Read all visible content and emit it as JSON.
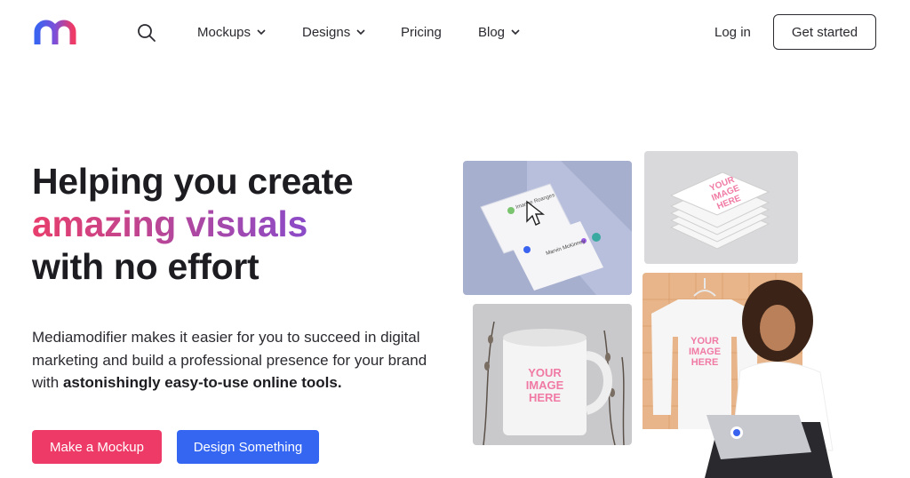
{
  "header": {
    "nav": [
      {
        "label": "Mockups",
        "has_dropdown": true
      },
      {
        "label": "Designs",
        "has_dropdown": true
      },
      {
        "label": "Pricing",
        "has_dropdown": false
      },
      {
        "label": "Blog",
        "has_dropdown": true
      }
    ],
    "login_label": "Log in",
    "get_started_label": "Get started"
  },
  "hero": {
    "title_line1": "Helping you create",
    "title_line2": "amazing visuals",
    "title_line3": "with no effort",
    "description_plain": "Mediamodifier makes it easier for you to succeed in digital marketing and build a professional presence for your brand with ",
    "description_bold": "astonishingly easy-to-use online tools.",
    "primary_button": "Make a Mockup",
    "secondary_button": "Design Something"
  },
  "gallery": {
    "placeholder_text_line1": "YOUR",
    "placeholder_text_line2": "IMAGE",
    "placeholder_text_line3": "HERE",
    "card_name_1": "Imanne Roanges",
    "card_name_2": "Marvin McKinney"
  },
  "colors": {
    "brand_pink": "#ee3a66",
    "brand_blue": "#3466f2",
    "gradient_start": "#e83e6c",
    "gradient_end": "#8b4bc8"
  }
}
